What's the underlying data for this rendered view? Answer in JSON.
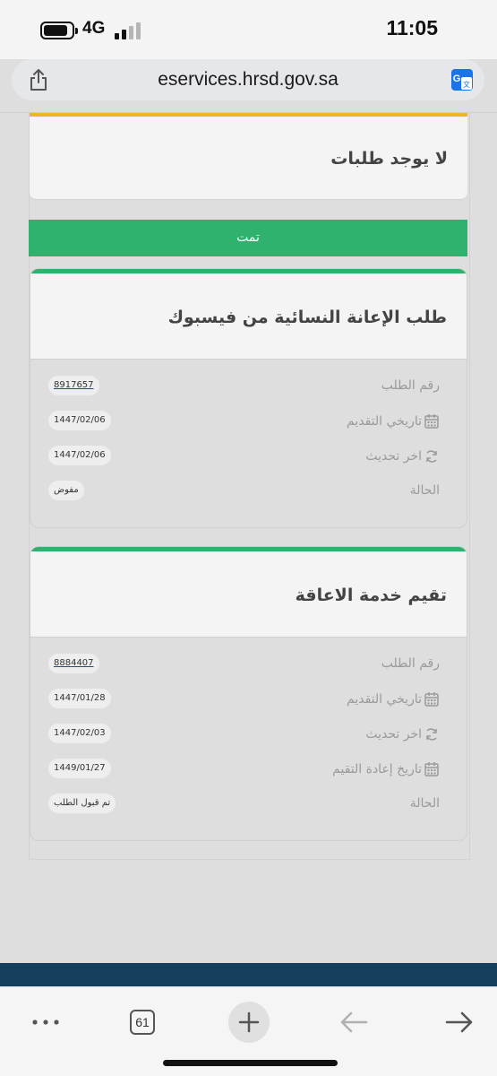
{
  "status_bar": {
    "network": "4G",
    "time": "11:05"
  },
  "browser": {
    "url": "eservices.hrsd.gov.sa",
    "tabs_count": "61"
  },
  "summary_card": {
    "title": "لا يوجد طلبات"
  },
  "section_bar": {
    "label": "تمت"
  },
  "requests": [
    {
      "title": "طلب الإعانة النسائية من فيسبوك",
      "rows": [
        {
          "label": "رقم الطلب",
          "value": "8917657",
          "icon": ""
        },
        {
          "label": "تاريخي التقديم",
          "value": "1447/02/06",
          "icon": "calendar-icon"
        },
        {
          "label": "اخر تحديث",
          "value": "1447/02/06",
          "icon": "refresh-icon"
        },
        {
          "label": "الحالة",
          "value": "مفوض",
          "icon": ""
        }
      ]
    },
    {
      "title": "تقيم خدمة الاعاقة",
      "rows": [
        {
          "label": "رقم الطلب",
          "value": "8884407",
          "icon": ""
        },
        {
          "label": "تاريخي التقديم",
          "value": "1447/01/28",
          "icon": "calendar-icon"
        },
        {
          "label": "اخر تحديث",
          "value": "1447/02/03",
          "icon": "refresh-icon"
        },
        {
          "label": "تاريخ إعادة التقيم",
          "value": "1449/01/27",
          "icon": "calendar-icon"
        },
        {
          "label": "الحالة",
          "value": "تم قبول الطلب",
          "icon": ""
        }
      ]
    }
  ],
  "colors": {
    "success": "#2eb26e",
    "warning": "#f0b429",
    "footer": "#14405e"
  }
}
